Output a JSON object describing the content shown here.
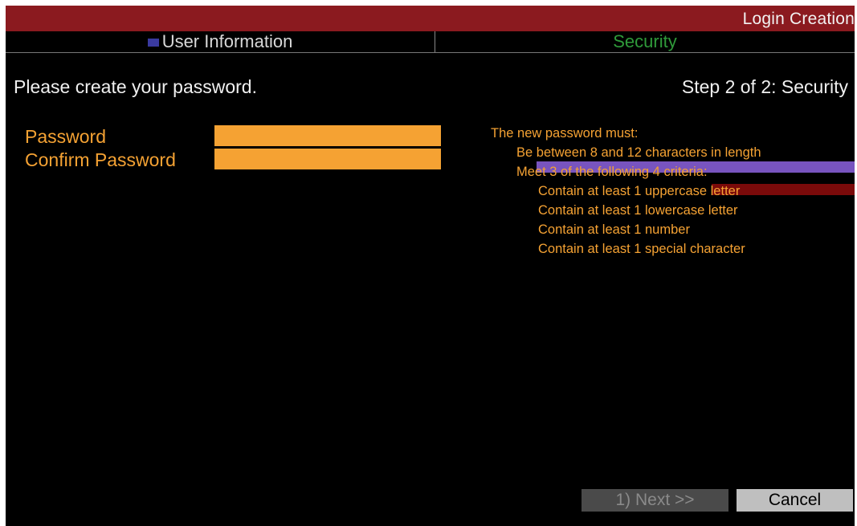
{
  "window": {
    "title": "Login Creation"
  },
  "tabs": [
    {
      "label": "User Information"
    },
    {
      "label": "Security"
    }
  ],
  "main": {
    "prompt": "Please create your password.",
    "step": "Step 2 of 2: Security"
  },
  "form": {
    "password_label": "Password",
    "confirm_label": "Confirm Password",
    "password_value": "",
    "confirm_value": ""
  },
  "rules": {
    "heading": "The new password must:",
    "length": "Be between 8 and 12 characters in length",
    "criteria_intro": "Meet 3 of the following 4 criteria:",
    "items": [
      "Contain at least 1 uppercase letter",
      "Contain at least 1 lowercase letter",
      "Contain at least 1 number",
      "Contain at least 1 special character"
    ]
  },
  "buttons": {
    "next": "1) Next >>",
    "cancel": "Cancel"
  },
  "colors": {
    "title_bar": "#8b1a1f",
    "accent_orange": "#f5a233",
    "active_tab": "#2f9a3a"
  }
}
